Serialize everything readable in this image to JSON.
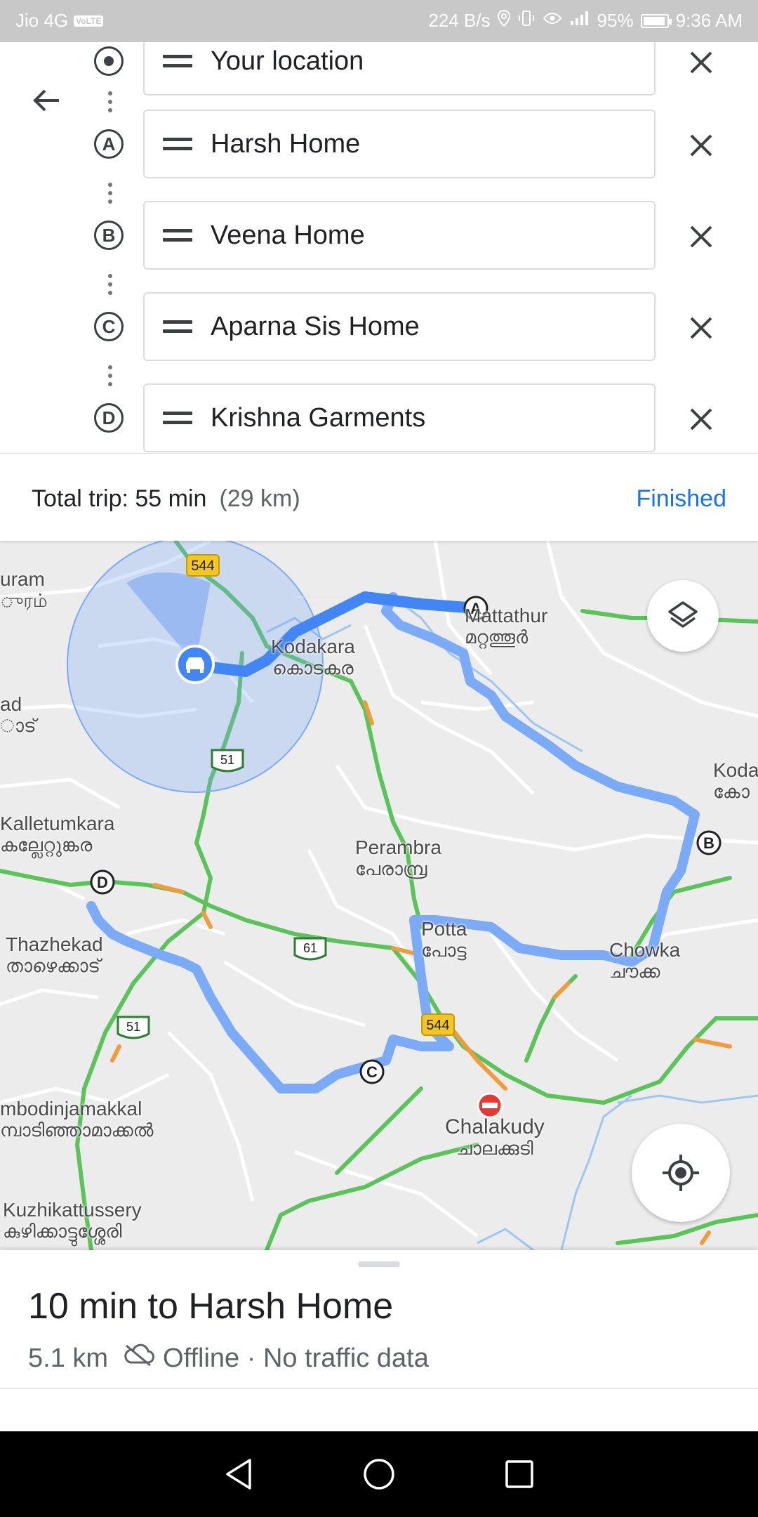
{
  "status_bar": {
    "carrier": "Jio 4G",
    "volte_badge": "VoLTE",
    "speed": "224 B/s",
    "battery": "95%",
    "battery_level": 0.95,
    "time": "9:36 AM"
  },
  "stops": [
    {
      "marker": "",
      "label": "Your location"
    },
    {
      "marker": "A",
      "label": "Harsh Home"
    },
    {
      "marker": "B",
      "label": "Veena Home"
    },
    {
      "marker": "C",
      "label": "Aparna Sis Home"
    },
    {
      "marker": "D",
      "label": "Krishna Garments"
    }
  ],
  "trip": {
    "total": "Total trip: 55 min",
    "distance": "(29 km)",
    "finished_label": "Finished"
  },
  "map": {
    "labels": {
      "uram": "uram",
      "uram_ml": "ுரம்",
      "ad": "ad",
      "ad_ml": "ാട്",
      "kodakara": "Kodakara",
      "kodakara_ml": "കൊടകര",
      "mattathur": "Mattathur",
      "mattathur_ml": "മറ്റത്തൂർ",
      "koda": "Koda",
      "koda_ml": "കോ",
      "kalletumkara": "Kalletumkara",
      "kalletumkara_ml": "കല്ലേറ്റുങ്കര",
      "perambra": "Perambra",
      "perambra_ml": "പേരാമ്പ്ര",
      "thazhekad": "Thazhekad",
      "thazhekad_ml": "താഴെക്കാട്",
      "potta": "Potta",
      "potta_ml": "പോട്ട",
      "chowka": "Chowka",
      "chowka_ml": "ചൗക്ക",
      "chalakudy": "Chalakudy",
      "chalakudy_ml": "ചാലക്കുടി",
      "ambodinjamakkal": "mbodinjamakkal",
      "ambodinjamakkal_ml": "മ്പാടിഞ്ഞാമാക്കൽ",
      "kuzhikattussery": "Kuzhikattussery",
      "kuzhikattussery_ml": "കുഴിക്കാട്ടുശ്ശേരി"
    },
    "shields": {
      "nh544_top": "544",
      "nh544_bottom": "544",
      "sh51_a": "51",
      "sh51_b": "51",
      "sh61": "61"
    },
    "waypoints": {
      "a": "A",
      "b": "B",
      "c": "C",
      "d": "D"
    }
  },
  "sheet": {
    "title": "10 min to Harsh Home",
    "distance": "5.1 km",
    "status": "Offline · No traffic data"
  },
  "colors": {
    "route_blue": "#4285f4",
    "route_light": "#7baaf7",
    "traffic_green": "#5ac35a",
    "traffic_orange": "#f29b3c",
    "accent": "#1a73e8"
  }
}
